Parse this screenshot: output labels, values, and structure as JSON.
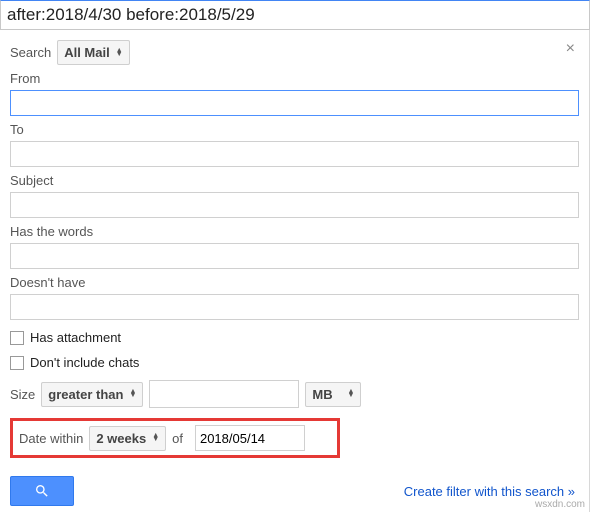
{
  "topbar": {
    "query": "after:2018/4/30 before:2018/5/29"
  },
  "close_icon": "×",
  "search_row": {
    "label": "Search",
    "scope": "All Mail"
  },
  "fields": {
    "from": {
      "label": "From",
      "value": ""
    },
    "to": {
      "label": "To",
      "value": ""
    },
    "subject": {
      "label": "Subject",
      "value": ""
    },
    "has_words": {
      "label": "Has the words",
      "value": ""
    },
    "doesnt_have": {
      "label": "Doesn't have",
      "value": ""
    }
  },
  "checks": {
    "has_attachment": "Has attachment",
    "dont_include_chats": "Don't include chats"
  },
  "size": {
    "label": "Size",
    "op": "greater than",
    "value": "",
    "unit": "MB"
  },
  "date": {
    "label": "Date within",
    "range": "2 weeks",
    "of_label": "of",
    "of_value": "2018/05/14"
  },
  "footer": {
    "create_filter": "Create filter with this search »"
  },
  "watermark": "wsxdn.com"
}
